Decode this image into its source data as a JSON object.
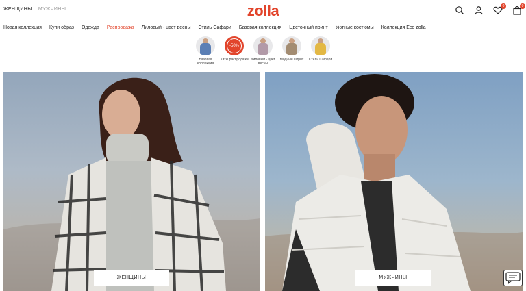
{
  "header": {
    "gender_tabs": [
      {
        "label": "Женщины",
        "state": "active"
      },
      {
        "label": "Мужчины",
        "state": "inactive"
      }
    ],
    "logo": "zolla",
    "icons": [
      "search-icon",
      "user-icon",
      "heart-icon",
      "cart-icon"
    ],
    "favorites_count": "0",
    "cart_count": "0"
  },
  "nav": {
    "items": [
      "Новая коллекция",
      "Купи образ",
      "Одежда",
      "Распродажа",
      "Лиловый - цвет весны",
      "Стиль Сафари",
      "Базовая коллекция",
      "Цветочный принт",
      "Уютные костюмы",
      "Коллекция Eco zolla"
    ]
  },
  "categories": [
    {
      "label": "Базовая коллекция",
      "color": "#5b7fb5"
    },
    {
      "label": "Хиты распродажи",
      "badge": "-50%",
      "color": "#e2452c"
    },
    {
      "label": "Лиловый - цвет весны",
      "color": "#b29aa8"
    },
    {
      "label": "Модный штрих",
      "color": "#a38c72"
    },
    {
      "label": "Стиль Сафари",
      "color": "#e3b844"
    }
  ],
  "hero": {
    "women_button": "Женщины",
    "men_button": "Мужчины"
  },
  "colors": {
    "brand": "#e2452c"
  }
}
